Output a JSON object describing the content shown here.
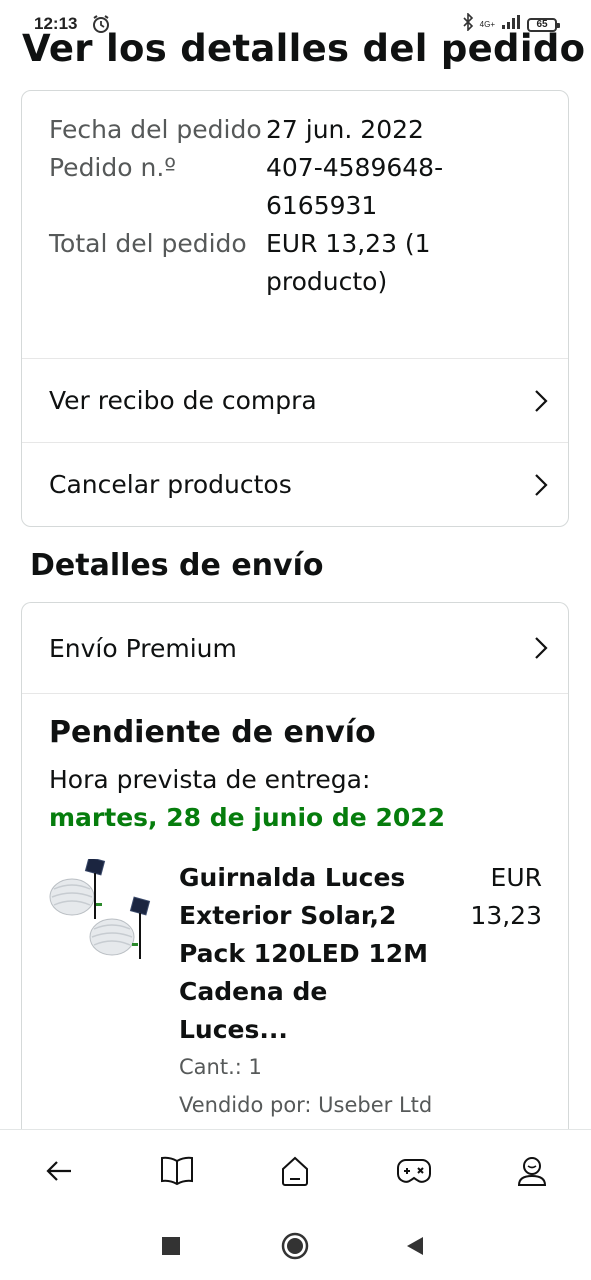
{
  "status_bar": {
    "time": "12:13",
    "network": "4G+",
    "battery": "65"
  },
  "page": {
    "title": "Ver los detalles del pedido"
  },
  "order": {
    "details": [
      {
        "label": "Fecha del pedido",
        "value": "27 jun. 2022"
      },
      {
        "label": "Pedido n.º",
        "value": "407-4589648-6165931"
      },
      {
        "label": "Total del pedido",
        "value": "EUR 13,23 (1 producto)"
      }
    ],
    "links": [
      {
        "label": "Ver recibo de compra"
      },
      {
        "label": "Cancelar productos"
      }
    ]
  },
  "shipping": {
    "section_title": "Detalles de envío",
    "method": "Envío Premium",
    "status": "Pendiente de envío",
    "eta_label": "Hora prevista de entrega:",
    "eta_date": "martes, 28 de junio de 2022",
    "product": {
      "name": "Guirnalda Luces Exterior Solar,2 Pack 120LED 12M Cadena de Luces...",
      "price": "EUR 13,23",
      "quantity": "Cant.: 1",
      "seller": "Vendido por: Useber Ltd"
    },
    "colors": {
      "eta": "#067d0d"
    }
  },
  "bottom_nav": {
    "items": [
      {
        "icon": "back-arrow-icon"
      },
      {
        "icon": "book-icon"
      },
      {
        "icon": "home-icon"
      },
      {
        "icon": "gamepad-icon"
      },
      {
        "icon": "account-icon"
      }
    ]
  },
  "system_nav": {
    "items": [
      "recent-apps-icon",
      "home-circle-icon",
      "back-triangle-icon"
    ]
  }
}
